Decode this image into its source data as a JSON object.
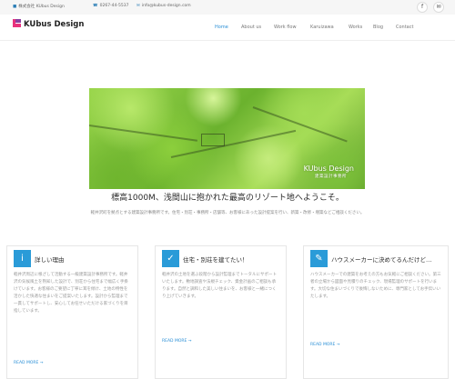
{
  "topbar": {
    "company": "株式会社 KUbus Design",
    "phone": "0267-44-5537",
    "email": "info@kubus-design.com",
    "social": [
      "f",
      "✉"
    ]
  },
  "header": {
    "logo_text": "KUbus Design",
    "nav": [
      {
        "label": "Home",
        "active": true
      },
      {
        "label": "About us",
        "active": false
      },
      {
        "label": "Work flow",
        "active": false
      },
      {
        "label": "Karuizawa",
        "active": false
      },
      {
        "label": "Works",
        "active": false
      },
      {
        "label": "Blog",
        "active": false
      },
      {
        "label": "Contact",
        "active": false
      }
    ]
  },
  "hero": {
    "title": "KUbus Design",
    "subtitle": "建築設計事務所"
  },
  "main": {
    "tagline": "標高1000M、浅間山に抱かれた最高のリゾート地へようこそ。",
    "subline": "軽井沢町を拠点とする建築設計事務所です。住宅・別荘・事務所・店舗等、お客様にあった設計提案を行い、新築・改修・増築などご相談ください。"
  },
  "cards": [
    {
      "icon": "info-icon",
      "glyph": "i",
      "title": "詳しい理由",
      "text": "軽井沢周辺に根ざして活動する一級建築設計事務所です。軽井沢の気候風土を熟知した設計で、別荘から住宅まで幅広く手掛けています。お客様のご要望に丁寧に耳を傾け、土地の特性を活かした快適な住まいをご提案いたします。設計から監理まで一貫してサポートし、安心してお任せいただける家づくりを目指しています。",
      "more": "READ MORE →"
    },
    {
      "icon": "check-icon",
      "glyph": "✓",
      "title": "住宅・別荘を建てたい！",
      "text": "軽井沢の土地を選ぶ段階から設計監理までトータルにサポートいたします。敷地調査や法規チェック、資金計画のご相談も承ります。自然と調和した美しい住まいを、お客様と一緒につくり上げていきます。",
      "more": "READ MORE →"
    },
    {
      "icon": "edit-icon",
      "glyph": "✎",
      "title": "ハウスメーカーに決めてるんだけど…",
      "text": "ハウスメーカーでの建築をお考えの方もお気軽にご相談ください。第三者の立場から図面や見積りのチェック、現場監理のサポートを行います。大切な住まいづくりで後悔しないために、専門家としてお手伝いいたします。",
      "more": "READ MORE →"
    }
  ],
  "colors": {
    "accent": "#2a9bd8",
    "logo_pink": "#e8327d",
    "logo_purple": "#8b3fa0"
  }
}
